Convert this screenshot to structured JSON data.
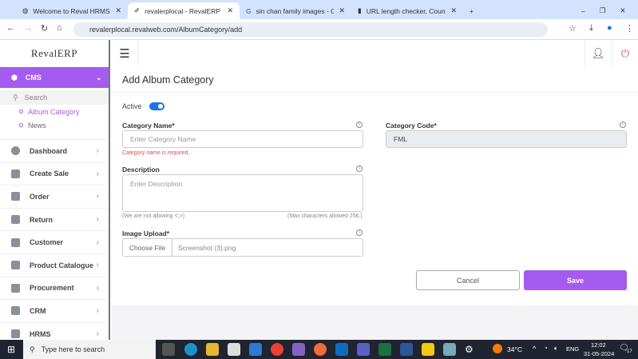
{
  "browser": {
    "tabs": [
      {
        "title": "Welcome to Reval HRMS"
      },
      {
        "title": "revalerplocal - RevalERP - Add A"
      },
      {
        "title": "sin chan family images - Google"
      },
      {
        "title": "URL length checker, Count Cha"
      }
    ],
    "url": "revalerplocal.revalweb.com/AlbumCategory/add"
  },
  "sidebar": {
    "logo": "RevalERP",
    "section": "CMS",
    "search_placeholder": "Search",
    "sub_items": [
      {
        "label": "Album Category",
        "active": true
      },
      {
        "label": "News",
        "active": false
      }
    ],
    "items": [
      {
        "label": "Dashboard"
      },
      {
        "label": "Create Sale"
      },
      {
        "label": "Order"
      },
      {
        "label": "Return"
      },
      {
        "label": "Customer"
      },
      {
        "label": "Product Catalogue"
      },
      {
        "label": "Procurement"
      },
      {
        "label": "CRM"
      },
      {
        "label": "HRMS"
      }
    ]
  },
  "page": {
    "title": "Add Album Category",
    "active_label": "Active",
    "active": true,
    "category_name": {
      "label": "Category Name*",
      "placeholder": "Enter Category Name",
      "value": "",
      "error": "Category name is required."
    },
    "category_code": {
      "label": "Category Code*",
      "value": "FML"
    },
    "description": {
      "label": "Description",
      "placeholder": "Enter Description",
      "hint_left": "(We are not allowing <,>)",
      "hint_right": "(Max characters allowed 256.)"
    },
    "image_upload": {
      "label": "Image Upload*",
      "button": "Choose File",
      "file": "Screenshot (3).png"
    },
    "cancel": "Cancel",
    "save": "Save"
  },
  "colors": {
    "accent": "#a55bf0",
    "toggle": "#1a73e8",
    "error": "#e5484d"
  },
  "taskbar": {
    "search_placeholder": "Type here to search",
    "weather": "34°C",
    "lang": "ENG",
    "time": "12:02",
    "date": "31-05-2024",
    "notifications": "17"
  }
}
